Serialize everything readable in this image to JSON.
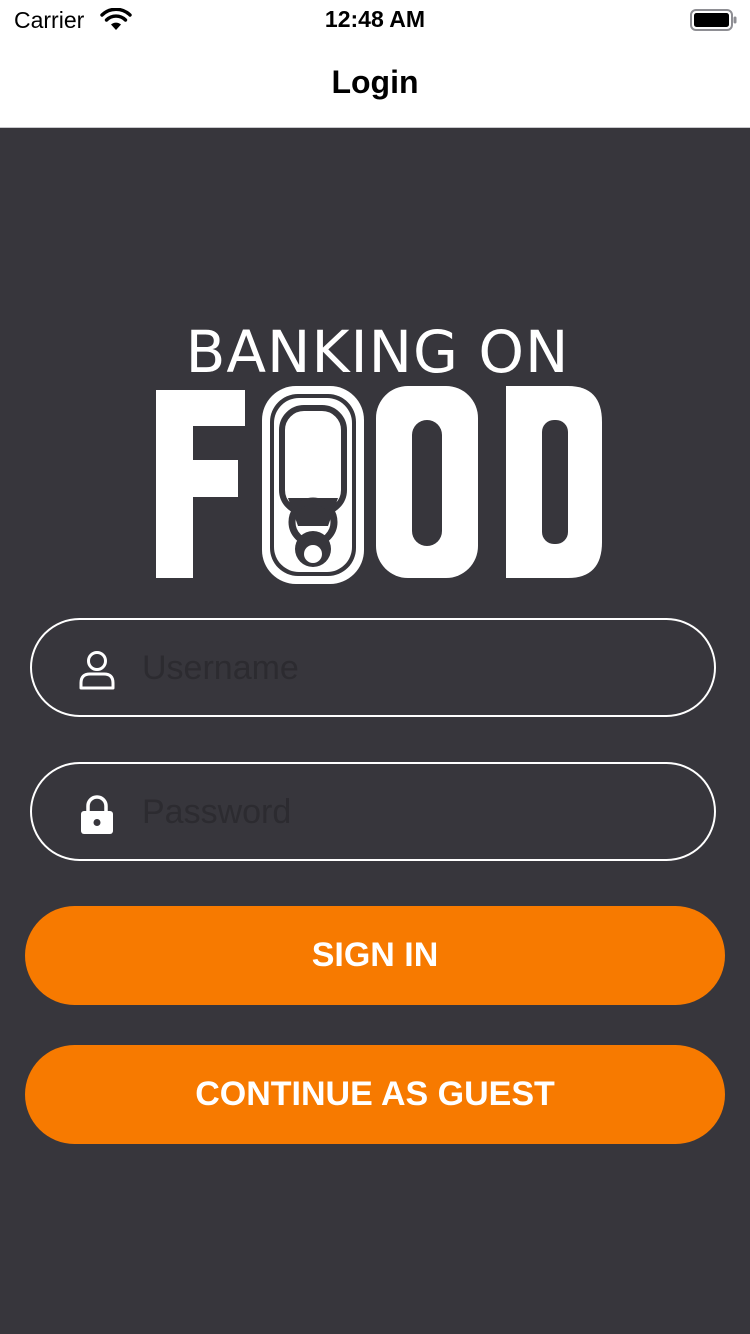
{
  "status_bar": {
    "carrier": "Carrier",
    "time": "12:48 AM",
    "wifi_icon": "wifi-icon",
    "battery_icon": "battery-icon"
  },
  "nav": {
    "title": "Login"
  },
  "logo": {
    "line1": "BANKING ON",
    "line2": "FOOD"
  },
  "form": {
    "username": {
      "placeholder": "Username",
      "value": "",
      "icon": "user-icon"
    },
    "password": {
      "placeholder": "Password",
      "value": "",
      "icon": "lock-icon"
    }
  },
  "buttons": {
    "sign_in": "SIGN IN",
    "guest": "CONTINUE AS GUEST"
  },
  "colors": {
    "background": "#37363c",
    "accent": "#f77a00",
    "text_on_accent": "#ffffff"
  }
}
